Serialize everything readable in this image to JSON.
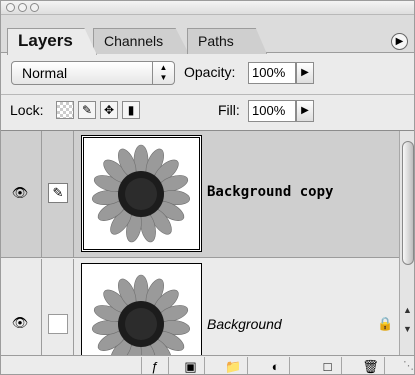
{
  "tabs": {
    "layers": "Layers",
    "channels": "Channels",
    "paths": "Paths"
  },
  "options": {
    "blend_mode": "Normal",
    "opacity_label": "Opacity:",
    "opacity_value": "100%",
    "lock_label": "Lock:",
    "fill_label": "Fill:",
    "fill_value": "100%"
  },
  "layers": [
    {
      "name": "Background copy",
      "style": "bold",
      "visible": true,
      "selected": true,
      "locked": false
    },
    {
      "name": "Background",
      "style": "italic",
      "visible": true,
      "selected": false,
      "locked": true
    }
  ],
  "colors": {
    "panel": "#ebebeb",
    "selected_row": "#cfcfcf",
    "border": "#9c9c9c"
  },
  "icons": {
    "menu": "menu-arrow-icon",
    "lock_transparency": "checker-lock-icon",
    "lock_paint": "brush-lock-icon",
    "lock_move": "move-lock-icon",
    "lock_all": "padlock-icon",
    "bottom": [
      "layer-style-icon",
      "mask-icon",
      "folder-icon",
      "adjustment-icon",
      "new-layer-icon",
      "trash-icon"
    ]
  }
}
